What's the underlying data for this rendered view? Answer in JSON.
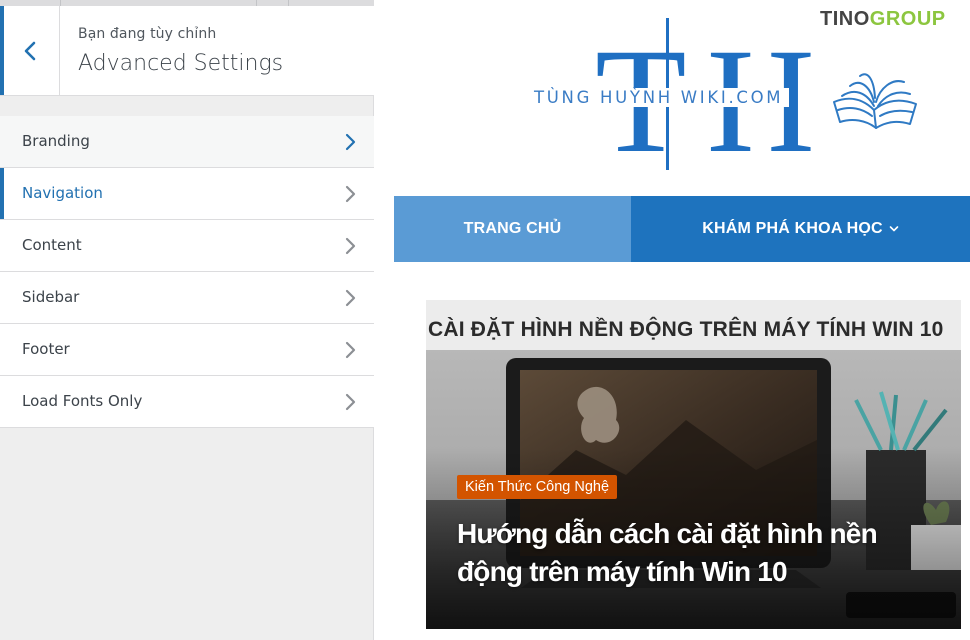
{
  "customizer": {
    "header": {
      "subtitle": "Bạn đang tùy chỉnh",
      "title": "Advanced Settings"
    },
    "sections": [
      {
        "label": "Branding",
        "state": "highlight"
      },
      {
        "label": "Navigation",
        "state": "active"
      },
      {
        "label": "Content",
        "state": "normal"
      },
      {
        "label": "Sidebar",
        "state": "normal"
      },
      {
        "label": "Footer",
        "state": "normal"
      },
      {
        "label": "Load Fonts Only",
        "state": "normal"
      }
    ],
    "icons": {
      "back": "chevron-left-icon",
      "section": "chevron-right-icon"
    },
    "colors": {
      "accent": "#2271b1",
      "panel_bg": "#eeeeee"
    }
  },
  "preview": {
    "watermark": {
      "part1": "TINO",
      "part2": "GROUP"
    },
    "site_logo": {
      "monogram": "TH",
      "wordmark": "TÙNG HUỲNH WIKI.COM",
      "icon": "open-book-icon"
    },
    "nav": {
      "home": "TRANG CHỦ",
      "discover": "KHÁM PHÁ KHOA HỌC",
      "discover_icon": "chevron-down-icon"
    },
    "featured_post": {
      "banner_title": "CÀI ĐẶT HÌNH NỀN ĐỘNG TRÊN MÁY TÍNH WIN 10",
      "category": "Kiến Thức Công Nghệ",
      "title": "Hướng dẫn cách cài đặt hình nền động trên máy tính Win 10"
    },
    "colors": {
      "nav": "#1e73be",
      "nav_active": "#5a9bd5",
      "category": "#d35400",
      "logo": "#1f6fc2",
      "watermark_accent": "#8cc63f"
    }
  }
}
